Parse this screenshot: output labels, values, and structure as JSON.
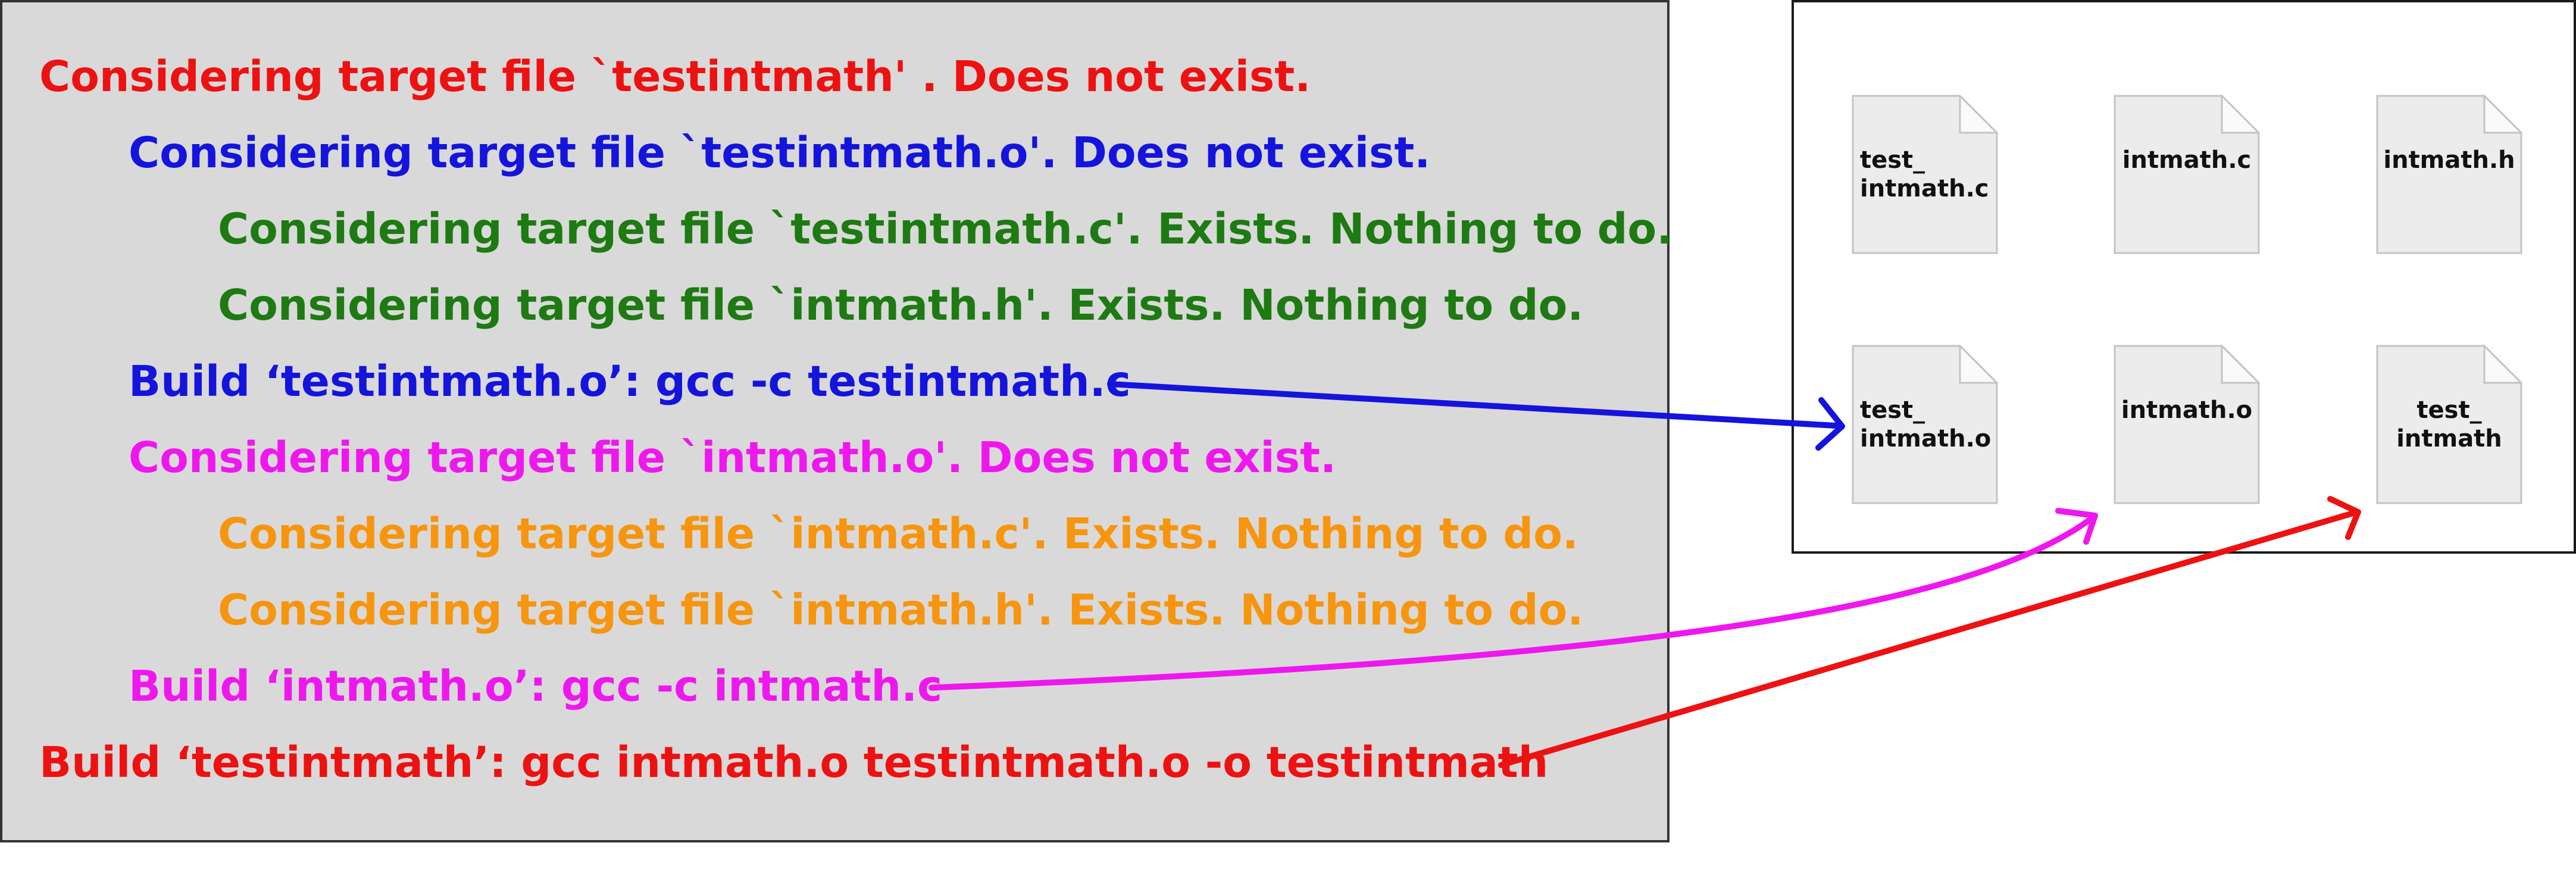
{
  "log_lines": [
    {
      "text": "Considering target file `testintmath' . Does not exist.",
      "color": "#ee1111"
    },
    {
      "text": "Considering target file `testintmath.o'. Does not exist.",
      "color": "#1414dd"
    },
    {
      "text": "Considering target file `testintmath.c'. Exists. Nothing to do.",
      "color": "#1e7a12"
    },
    {
      "text": "Considering target file `intmath.h'. Exists. Nothing to do.",
      "color": "#1e7a12"
    },
    {
      "text": "Build ‘testintmath.o’: gcc -c testintmath.c",
      "color": "#1414dd"
    },
    {
      "text": "Considering target file `intmath.o'. Does not exist.",
      "color": "#ee18ee"
    },
    {
      "text": "Considering target file `intmath.c'. Exists. Nothing to do.",
      "color": "#f7950e"
    },
    {
      "text": "Considering target file `intmath.h'. Exists. Nothing to do.",
      "color": "#f7950e"
    },
    {
      "text": "Build ‘intmath.o’: gcc -c intmath.c",
      "color": "#ee18ee"
    },
    {
      "text": "Build ‘testintmath’: gcc intmath.o testintmath.o -o testintmath",
      "color": "#ee1111"
    }
  ],
  "files": [
    {
      "label": "test_\nintmath.c",
      "icon": "document-icon"
    },
    {
      "label": "intmath.c",
      "icon": "document-icon"
    },
    {
      "label": "intmath.h",
      "icon": "document-icon"
    },
    {
      "label": "test_\nintmath.o",
      "icon": "document-icon"
    },
    {
      "label": "intmath.o",
      "icon": "document-icon"
    },
    {
      "label": "test_\nintmath",
      "icon": "document-icon"
    }
  ],
  "arrows": [
    {
      "from": "Build ‘testintmath.o’",
      "to": "test_intmath.o",
      "color": "#1414dd"
    },
    {
      "from": "Build ‘intmath.o’",
      "to": "intmath.o",
      "color": "#ee18ee"
    },
    {
      "from": "Build ‘testintmath’",
      "to": "test_intmath",
      "color": "#ee1111"
    }
  ]
}
